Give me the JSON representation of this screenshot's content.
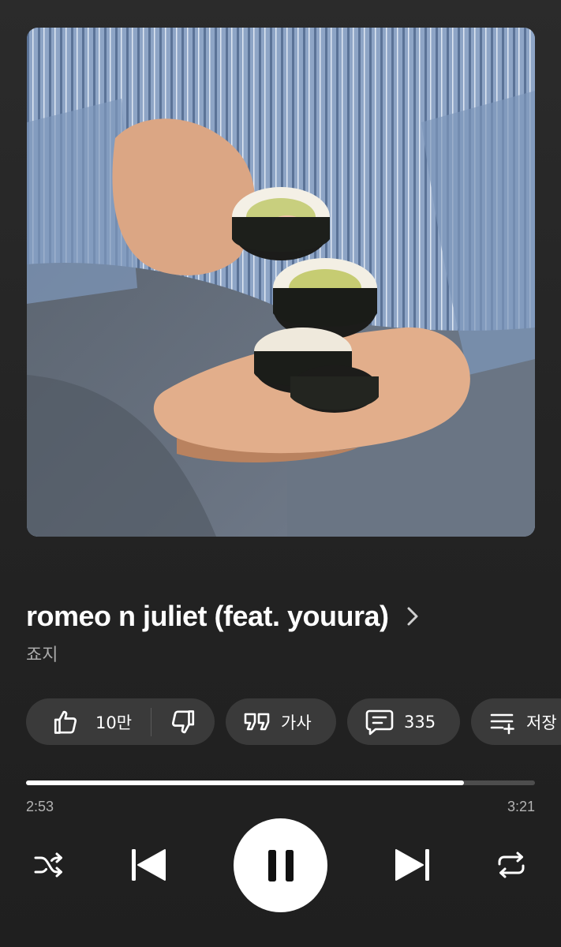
{
  "song": {
    "title": "romeo n juliet (feat. youura)",
    "artist": "죠지"
  },
  "actions": {
    "likes_count": "10만",
    "lyrics_label": "가사",
    "comments_count": "335",
    "save_label": "저장"
  },
  "playback": {
    "current_time": "2:53",
    "total_time": "3:21",
    "progress": 0.86,
    "state": "playing"
  },
  "icons": {
    "like": "thumbs-up-icon",
    "dislike": "thumbs-down-icon",
    "lyrics": "quote-icon",
    "comments": "comment-icon",
    "save": "playlist-add-icon",
    "shuffle": "shuffle-icon",
    "previous": "skip-previous-icon",
    "pause": "pause-icon",
    "next": "skip-next-icon",
    "repeat": "repeat-icon"
  },
  "colors": {
    "background": "#262626",
    "chip": "#3a3a3a",
    "accent": "#ffffff",
    "track": "#4d4d4d"
  }
}
